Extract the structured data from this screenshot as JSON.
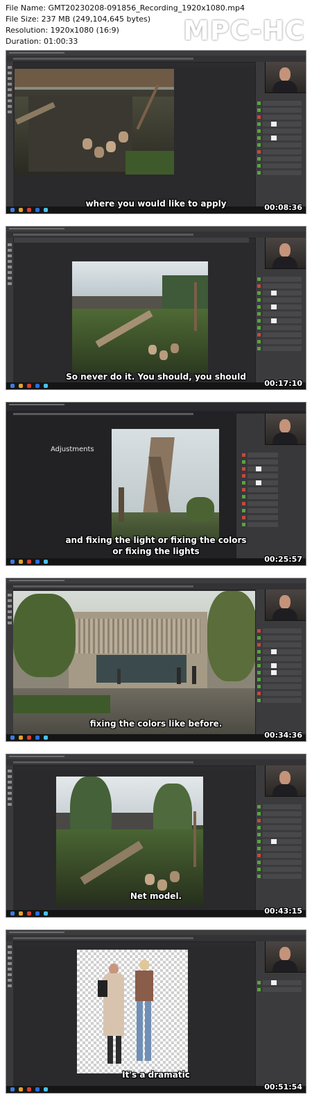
{
  "file_info": {
    "file_name": "File Name: GMT20230208-091856_Recording_1920x1080.mp4",
    "file_size": "File Size: 237 MB (249,104,645 bytes)",
    "resolution": "Resolution: 1920x1080 (16:9)",
    "duration": "Duration: 01:00:33"
  },
  "logo": "MPC-HC",
  "adjustments_label": "Adjustments",
  "thumbnails": [
    {
      "subtitle": "where you would like to apply",
      "timestamp": "00:08:36"
    },
    {
      "subtitle": "So never do it. You should, you should",
      "timestamp": "00:17:10"
    },
    {
      "subtitle": "and fixing the light or fixing the colors\nor fixing the lights",
      "timestamp": "00:25:57"
    },
    {
      "subtitle": "fixing the colors like before.",
      "timestamp": "00:34:36"
    },
    {
      "subtitle": "Net model.",
      "timestamp": "00:43:15"
    },
    {
      "subtitle": "It's a dramatic",
      "timestamp": "00:51:54"
    }
  ],
  "colors": {
    "app_background": "#2c2c2e",
    "panel": "#3b3b3e",
    "layer_green": "#5aa33f",
    "layer_red": "#c24a3f"
  }
}
